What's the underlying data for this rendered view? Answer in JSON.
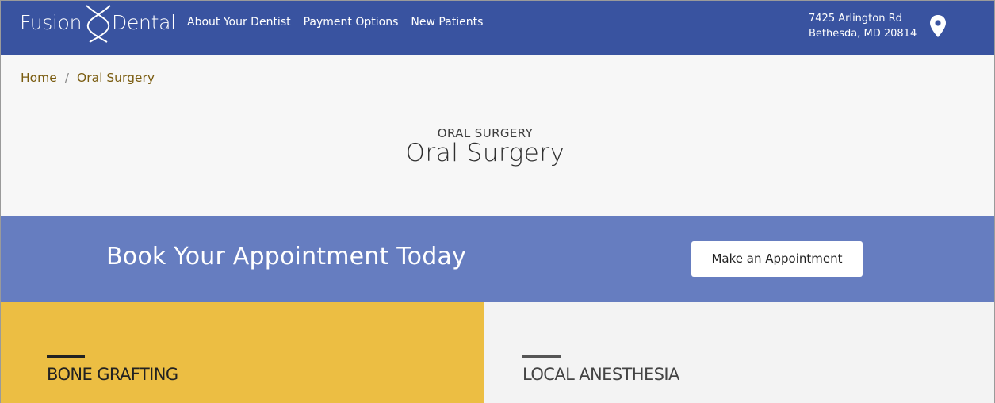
{
  "brand": {
    "word1": "Fusion",
    "word2": "Dental"
  },
  "nav": [
    "About Your Dentist",
    "Payment Options",
    "New Patients"
  ],
  "address": {
    "line1": "7425 Arlington Rd",
    "line2": "Bethesda, MD 20814"
  },
  "breadcrumb": {
    "home": "Home",
    "separator": "/",
    "current": "Oral Surgery"
  },
  "hero": {
    "kicker": "ORAL SURGERY",
    "title": "Oral Surgery"
  },
  "banner": {
    "text": "Book Your Appointment Today",
    "button": "Make an Appointment"
  },
  "services": [
    "BONE GRAFTING",
    "LOCAL ANESTHESIA"
  ],
  "colors": {
    "header": "#3953a0",
    "banner": "#667dc0",
    "accent_yellow": "#ecbe43",
    "breadcrumb": "#7a5c10"
  }
}
